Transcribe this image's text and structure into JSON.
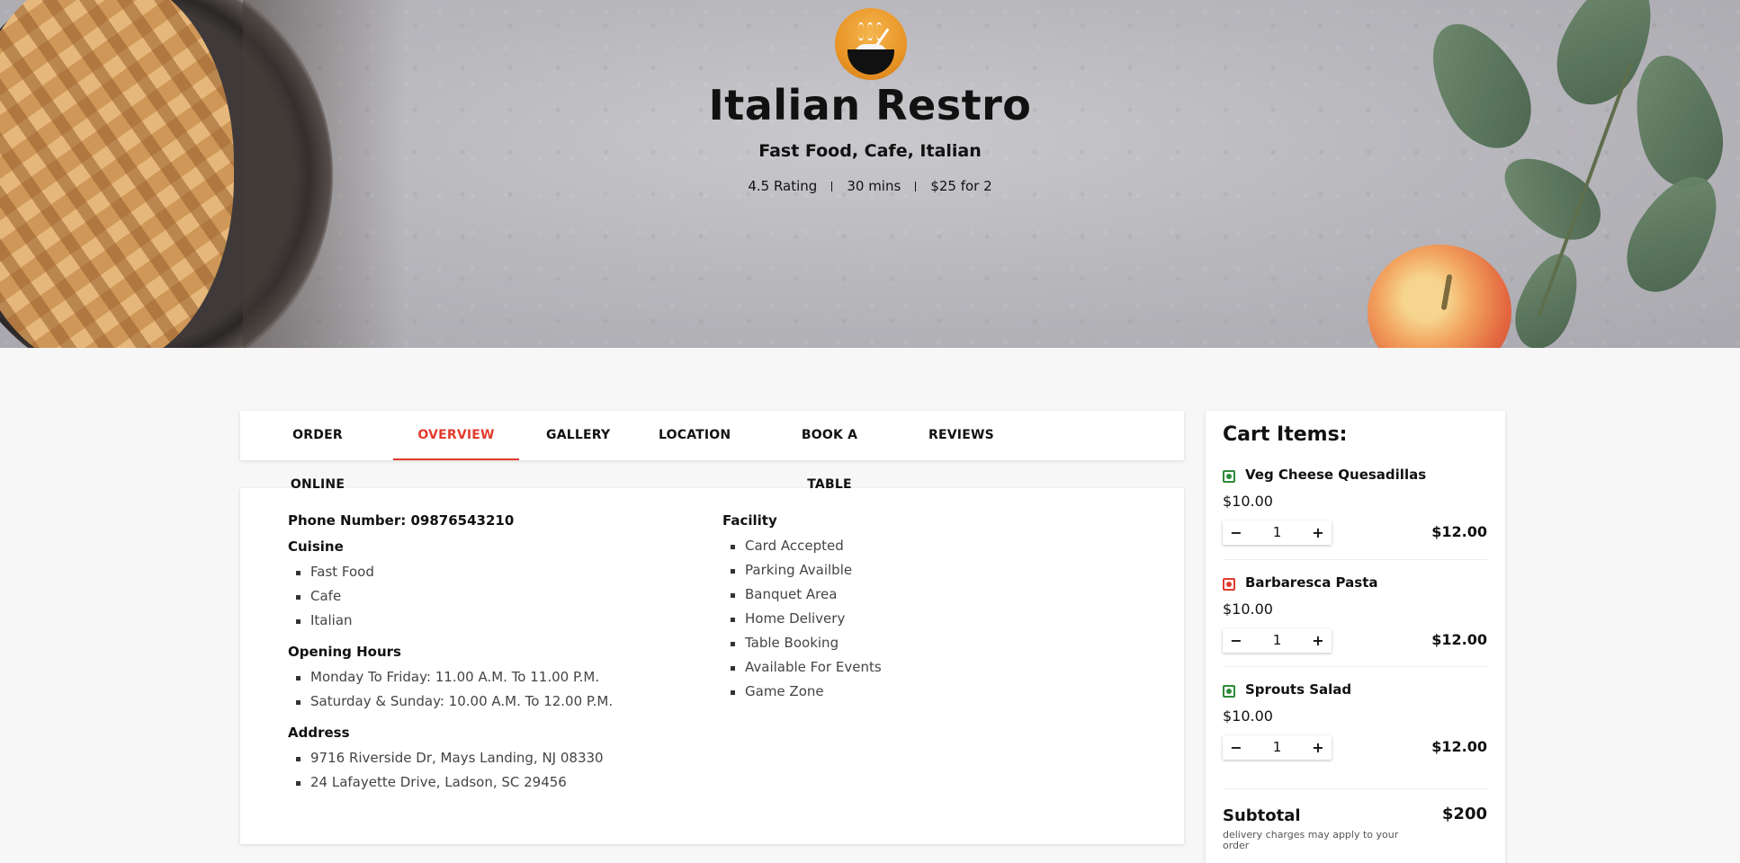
{
  "restaurant": {
    "name": "Italian Restro",
    "cuisines_line": "Fast Food, Cafe, Italian",
    "rating": "4.5 Rating",
    "delivery_time": "30 mins",
    "cost_for_two": "$25 for 2"
  },
  "tabs": [
    {
      "label": "ORDER ONLINE",
      "active": false
    },
    {
      "label": "OVERVIEW",
      "active": true
    },
    {
      "label": "GALLERY",
      "active": false
    },
    {
      "label": "LOCATION",
      "active": false
    },
    {
      "label": "BOOK A TABLE",
      "active": false
    },
    {
      "label": "REVIEWS",
      "active": false
    }
  ],
  "overview": {
    "phone": "Phone Number: 09876543210",
    "cuisine_title": "Cuisine",
    "cuisine": [
      "Fast Food",
      "Cafe",
      "Italian"
    ],
    "hours_title": "Opening Hours",
    "hours": [
      "Monday To Friday: 11.00 A.M. To 11.00 P.M.",
      "Saturday & Sunday: 10.00 A.M. To 12.00 P.M."
    ],
    "address_title": "Address",
    "address": [
      "9716 Riverside Dr, Mays Landing, NJ 08330",
      "24 Lafayette Drive, Ladson, SC 29456"
    ],
    "facility_title": "Facility",
    "facility": [
      "Card Accepted",
      "Parking Availble",
      "Banquet Area",
      "Home Delivery",
      "Table Booking",
      "Available For Events",
      "Game Zone"
    ]
  },
  "cart": {
    "title": "Cart Items:",
    "items": [
      {
        "name": "Veg Cheese Quesadillas",
        "price": "$10.00",
        "qty": "1",
        "total": "$12.00",
        "diet": "veg",
        "minus": "−",
        "plus": "+"
      },
      {
        "name": "Barbaresca Pasta",
        "price": "$10.00",
        "qty": "1",
        "total": "$12.00",
        "diet": "non-veg",
        "minus": "−",
        "plus": "+"
      },
      {
        "name": "Sprouts Salad",
        "price": "$10.00",
        "qty": "1",
        "total": "$12.00",
        "diet": "veg",
        "minus": "−",
        "plus": "+"
      }
    ],
    "subtotal_label": "Subtotal",
    "subtotal_value": "$200",
    "subtotal_note": "delivery charges may apply to your order"
  },
  "colors": {
    "accent": "#e23b2e",
    "veg": "#2e8b3a",
    "non_veg": "#e23b2e"
  }
}
